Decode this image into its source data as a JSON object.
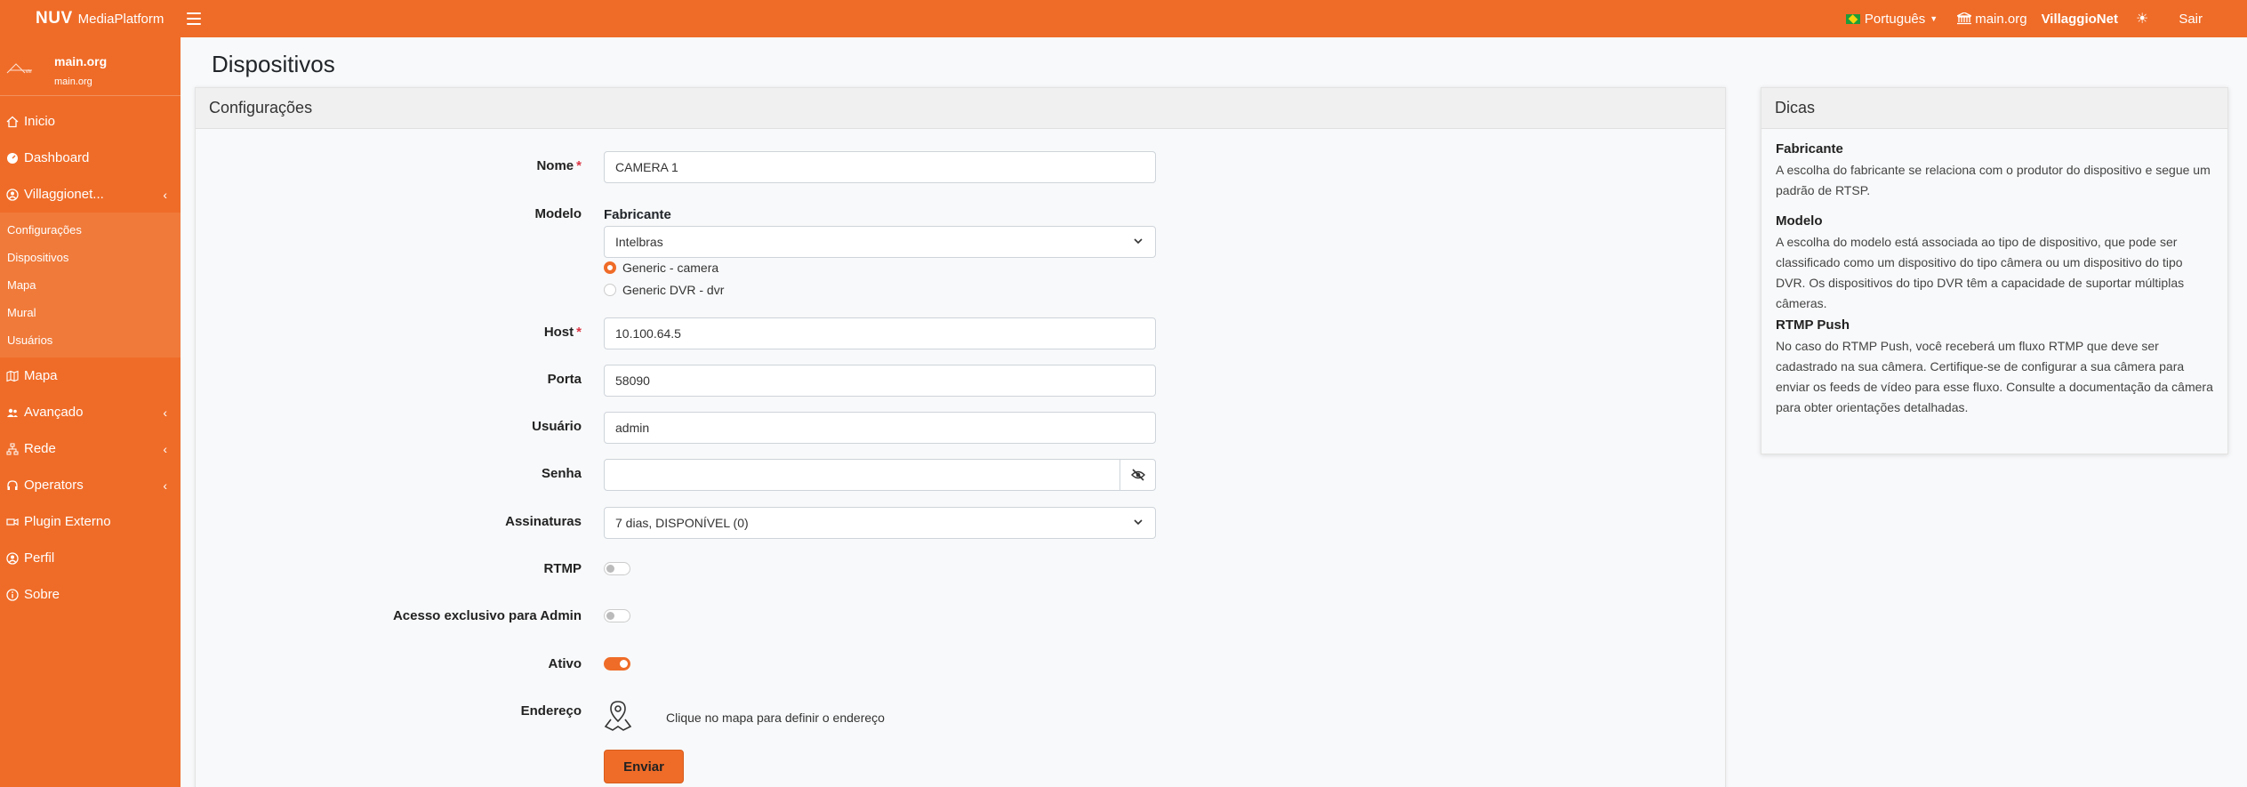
{
  "header": {
    "brand_bold": "NUV",
    "brand_name": "MediaPlatform",
    "language": "Português",
    "org_link": "main.org",
    "org_bold": "VillaggioNet",
    "logout": "Sair"
  },
  "sidebar": {
    "user_name": "main.org",
    "user_sub": "main.org",
    "items": [
      {
        "label": "Inicio",
        "icon": "home-icon"
      },
      {
        "label": "Dashboard",
        "icon": "dashboard-icon"
      },
      {
        "label": "Villaggionet...",
        "icon": "user-circle-icon"
      }
    ],
    "subitems": [
      "Configurações",
      "Dispositivos",
      "Mapa",
      "Mural",
      "Usuários"
    ],
    "items_after": [
      {
        "label": "Mapa",
        "icon": "map-icon"
      },
      {
        "label": "Avançado",
        "icon": "users-icon"
      },
      {
        "label": "Rede",
        "icon": "network-icon"
      },
      {
        "label": "Operators",
        "icon": "headset-icon"
      },
      {
        "label": "Plugin Externo",
        "icon": "video-icon"
      },
      {
        "label": "Perfil",
        "icon": "user-icon"
      },
      {
        "label": "Sobre",
        "icon": "info-icon"
      }
    ]
  },
  "page": {
    "title": "Dispositivos"
  },
  "form": {
    "card_title": "Configurações",
    "nome_label": "Nome",
    "nome_value": "CAMERA 1",
    "modelo_label": "Modelo",
    "fabricante_label": "Fabricante",
    "fabricante_value": "Intelbras",
    "radio_options": [
      "Generic - camera",
      "Generic DVR - dvr"
    ],
    "host_label": "Host",
    "host_value": "10.100.64.5",
    "porta_label": "Porta",
    "porta_value": "58090",
    "usuario_label": "Usuário",
    "usuario_value": "admin",
    "senha_label": "Senha",
    "senha_value": "",
    "assinaturas_label": "Assinaturas",
    "assinaturas_value": "7 dias, DISPONÍVEL (0)",
    "rtmp_label": "RTMP",
    "rtmp_on": false,
    "admin_label": "Acesso exclusivo para Admin",
    "admin_on": false,
    "ativo_label": "Ativo",
    "ativo_on": true,
    "endereco_label": "Endereço",
    "endereco_hint": "Clique no mapa para definir o endereço",
    "submit_label": "Enviar"
  },
  "tips": {
    "title": "Dicas",
    "items": [
      {
        "title": "Fabricante",
        "text": "A escolha do fabricante se relaciona com o produtor do dispositivo e segue um padrão de RTSP."
      },
      {
        "title": "Modelo",
        "text": "A escolha do modelo está associada ao tipo de dispositivo, que pode ser classificado como um dispositivo do tipo câmera ou um dispositivo do tipo DVR. Os dispositivos do tipo DVR têm a capacidade de suportar múltiplas câmeras."
      },
      {
        "title": "RTMP Push",
        "text": "No caso do RTMP Push, você receberá um fluxo RTMP que deve ser cadastrado na sua câmera. Certifique-se de configurar a sua câmera para enviar os feeds de vídeo para esse fluxo. Consulte a documentação da câmera para obter orientações detalhadas."
      }
    ]
  },
  "colors": {
    "accent": "#ef6c28",
    "required": "#dc3545"
  }
}
